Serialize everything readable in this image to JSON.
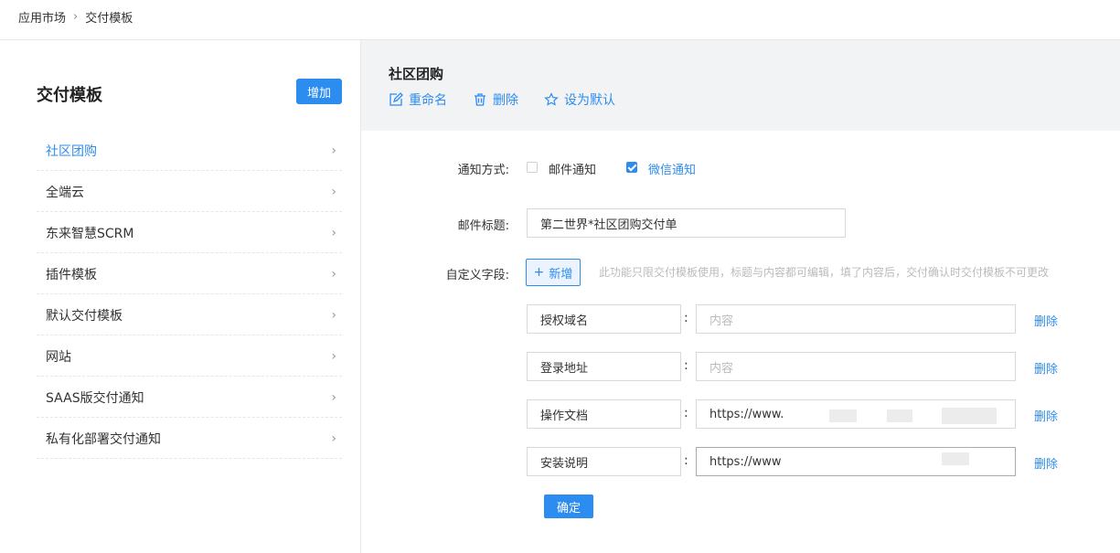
{
  "breadcrumb": {
    "root": "应用市场",
    "current": "交付模板"
  },
  "sidebar": {
    "title": "交付模板",
    "add_label": "增加",
    "items": [
      {
        "label": "社区团购",
        "active": true
      },
      {
        "label": "全端云"
      },
      {
        "label": "东来智慧SCRM"
      },
      {
        "label": "插件模板"
      },
      {
        "label": "默认交付模板"
      },
      {
        "label": "网站"
      },
      {
        "label": "SAAS版交付通知"
      },
      {
        "label": "私有化部署交付通知"
      }
    ]
  },
  "detail": {
    "title": "社区团购",
    "actions": {
      "rename": "重命名",
      "delete": "删除",
      "set_default": "设为默认"
    }
  },
  "form": {
    "notify_label": "通知方式:",
    "email_notify": {
      "label": "邮件通知",
      "checked": false
    },
    "wechat_notify": {
      "label": "微信通知",
      "checked": true
    },
    "email_title_label": "邮件标题:",
    "email_title_value": "第二世界*社区团购交付单",
    "custom_fields_label": "自定义字段:",
    "new_label": "新增",
    "hint": "此功能只限交付模板使用，标题与内容都可编辑，填了内容后，交付确认时交付模板不可更改",
    "colon": ":",
    "delete_label": "删除",
    "content_placeholder": "内容",
    "fields": [
      {
        "name": "授权域名",
        "value": ""
      },
      {
        "name": "登录地址",
        "value": ""
      },
      {
        "name": "操作文档",
        "value": "https://www."
      },
      {
        "name": "安装说明",
        "value": "https://www"
      }
    ],
    "confirm_label": "确定"
  },
  "colors": {
    "accent": "#2d8cf0",
    "header_bg": "#f2f3f5"
  }
}
